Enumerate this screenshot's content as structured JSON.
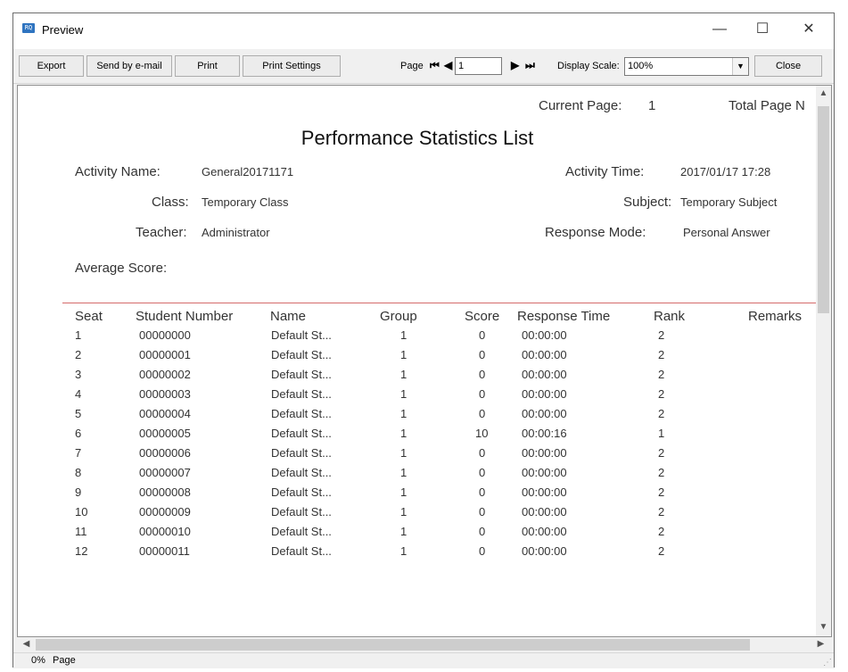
{
  "window": {
    "title": "Preview",
    "app_icon": "preview-app-icon",
    "minimize": "—",
    "maximize": "☐",
    "close": "✕"
  },
  "toolbar": {
    "export": "Export",
    "send_email": "Send by e-mail",
    "print": "Print",
    "print_settings": "Print Settings",
    "page_label": "Page",
    "page_value": "1",
    "display_scale_label": "Display Scale:",
    "display_scale_value": "100%",
    "close": "Close"
  },
  "report": {
    "current_page_label": "Current Page:",
    "current_page_value": "1",
    "total_page_label": "Total Page N",
    "title": "Performance Statistics List",
    "activity_name_label": "Activity Name:",
    "activity_name_value": "General20171171",
    "activity_time_label": "Activity Time:",
    "activity_time_value": "2017/01/17 17:28",
    "class_label": "Class:",
    "class_value": "Temporary Class",
    "subject_label": "Subject:",
    "subject_value": "Temporary Subject",
    "teacher_label": "Teacher:",
    "teacher_value": "Administrator",
    "response_mode_label": "Response Mode:",
    "response_mode_value": "Personal Answer",
    "average_score_label": "Average Score:",
    "columns": [
      "Seat",
      "Student Number",
      "Name",
      "Group",
      "Score",
      "Response Time",
      "Rank",
      "Remarks"
    ],
    "rows": [
      [
        "1",
        "00000000",
        "Default St...",
        "1",
        "0",
        "00:00:00",
        "2"
      ],
      [
        "2",
        "00000001",
        "Default St...",
        "1",
        "0",
        "00:00:00",
        "2"
      ],
      [
        "3",
        "00000002",
        "Default St...",
        "1",
        "0",
        "00:00:00",
        "2"
      ],
      [
        "4",
        "00000003",
        "Default St...",
        "1",
        "0",
        "00:00:00",
        "2"
      ],
      [
        "5",
        "00000004",
        "Default St...",
        "1",
        "0",
        "00:00:00",
        "2"
      ],
      [
        "6",
        "00000005",
        "Default St...",
        "1",
        "10",
        "00:00:16",
        "1"
      ],
      [
        "7",
        "00000006",
        "Default St...",
        "1",
        "0",
        "00:00:00",
        "2"
      ],
      [
        "8",
        "00000007",
        "Default St...",
        "1",
        "0",
        "00:00:00",
        "2"
      ],
      [
        "9",
        "00000008",
        "Default St...",
        "1",
        "0",
        "00:00:00",
        "2"
      ],
      [
        "10",
        "00000009",
        "Default St...",
        "1",
        "0",
        "00:00:00",
        "2"
      ],
      [
        "11",
        "00000010",
        "Default St...",
        "1",
        "0",
        "00:00:00",
        "2"
      ],
      [
        "12",
        "00000011",
        "Default St...",
        "1",
        "0",
        "00:00:00",
        "2"
      ]
    ]
  },
  "status": {
    "progress": "0%",
    "page": "Page"
  },
  "colors": {
    "rule": "#d46a6a",
    "window_bg": "#f0f0f0",
    "scroll_thumb": "#cdcdcd"
  }
}
